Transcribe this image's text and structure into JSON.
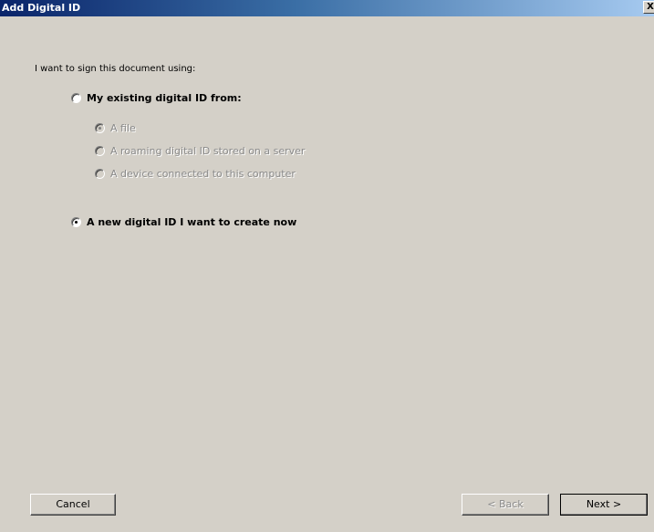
{
  "window": {
    "title": "Add Digital ID",
    "close_label": "X"
  },
  "content": {
    "prompt": "I want to sign this document using:",
    "options": [
      {
        "label": "My existing digital ID from:",
        "selected": false,
        "enabled": true
      },
      {
        "label": "A new digital ID I want to create now",
        "selected": true,
        "enabled": true
      }
    ],
    "sub_options": [
      {
        "label": "A file",
        "selected": true,
        "enabled": false
      },
      {
        "label": "A roaming digital ID stored on a server",
        "selected": false,
        "enabled": false
      },
      {
        "label": "A device connected to this computer",
        "selected": false,
        "enabled": false
      }
    ]
  },
  "buttons": {
    "cancel": "Cancel",
    "back": "< Back",
    "next": "Next >"
  }
}
